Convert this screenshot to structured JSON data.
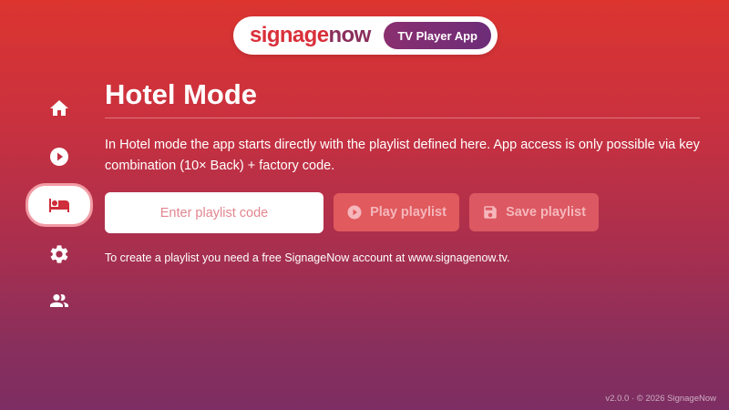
{
  "header": {
    "logo_part1": "signage",
    "logo_part2": "now",
    "app_badge": "TV Player App"
  },
  "sidebar": {
    "items": [
      {
        "name": "home",
        "icon": "home-icon",
        "active": false
      },
      {
        "name": "play",
        "icon": "play-circle-icon",
        "active": false
      },
      {
        "name": "hotel",
        "icon": "bed-icon",
        "active": true
      },
      {
        "name": "settings",
        "icon": "gear-icon",
        "active": false
      },
      {
        "name": "users",
        "icon": "users-icon",
        "active": false
      }
    ]
  },
  "main": {
    "title": "Hotel Mode",
    "description": "In Hotel mode the app starts directly with the playlist defined here. App access is only possible via key combination (10× Back) + factory code.",
    "input": {
      "placeholder": "Enter playlist code",
      "value": ""
    },
    "play_button": "Play playlist",
    "save_button": "Save playlist",
    "hint": "To create a playlist you need a free SignageNow account at www.signagenow.tv."
  },
  "footer": {
    "text": "v2.0.0 · © 2026 SignageNow"
  },
  "colors": {
    "gradient_top": "#dc3530",
    "gradient_bottom": "#7d2e62",
    "brand_red": "#d9303a",
    "brand_purple": "#8a2f5c",
    "button_disabled": "#e05a5e"
  }
}
